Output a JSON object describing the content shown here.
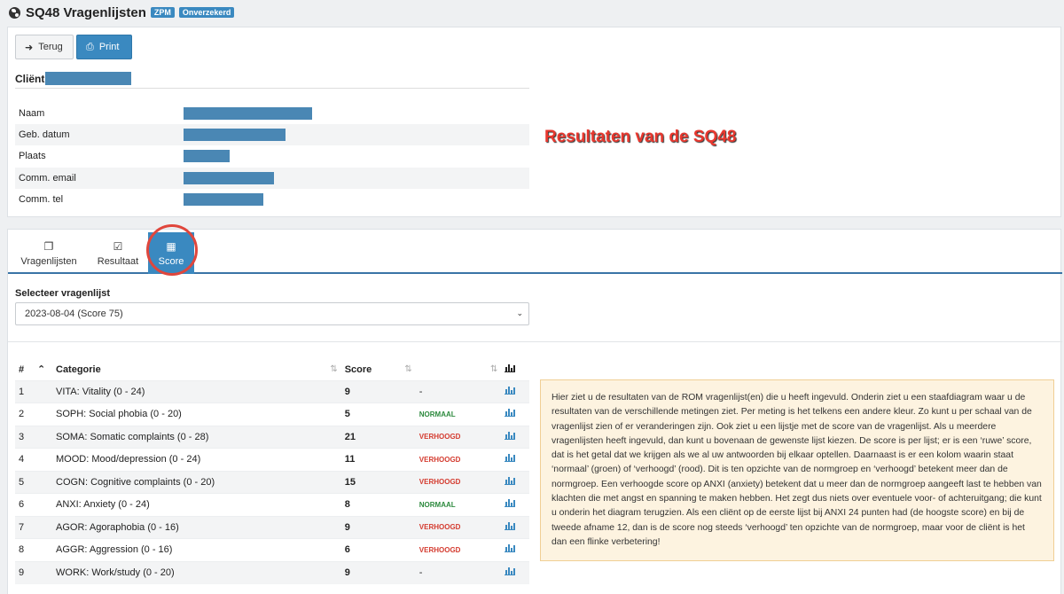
{
  "header": {
    "title": "SQ48 Vragenlijsten",
    "badges": [
      "ZPM",
      "Onverzekerd"
    ]
  },
  "toolbar": {
    "back_label": "Terug",
    "print_label": "Print"
  },
  "client": {
    "heading": "Cliënt",
    "fields": [
      {
        "label": "Naam"
      },
      {
        "label": "Geb. datum"
      },
      {
        "label": "Plaats"
      },
      {
        "label": "Comm. email"
      },
      {
        "label": "Comm. tel"
      }
    ]
  },
  "annotation": "Resultaten van de SQ48",
  "tabs": [
    {
      "label": "Vragenlijsten",
      "icon": "copy-icon"
    },
    {
      "label": "Resultaat",
      "icon": "checkbox-icon"
    },
    {
      "label": "Score",
      "icon": "calculator-icon",
      "active": true
    }
  ],
  "select": {
    "label": "Selecteer vragenlijst",
    "value": "2023-08-04 (Score 75)"
  },
  "table": {
    "headers": {
      "num": "#",
      "category": "Categorie",
      "score": "Score"
    },
    "rows": [
      {
        "num": "1",
        "category": "VITA: Vitality (0 - 24)",
        "score": "9",
        "status": "-"
      },
      {
        "num": "2",
        "category": "SOPH: Social phobia (0 - 20)",
        "score": "5",
        "status": "NORMAAL"
      },
      {
        "num": "3",
        "category": "SOMA: Somatic complaints (0 - 28)",
        "score": "21",
        "status": "VERHOOGD"
      },
      {
        "num": "4",
        "category": "MOOD: Mood/depression (0 - 24)",
        "score": "11",
        "status": "VERHOOGD"
      },
      {
        "num": "5",
        "category": "COGN: Cognitive complaints (0 - 20)",
        "score": "15",
        "status": "VERHOOGD"
      },
      {
        "num": "6",
        "category": "ANXI: Anxiety (0 - 24)",
        "score": "8",
        "status": "NORMAAL"
      },
      {
        "num": "7",
        "category": "AGOR: Agoraphobia (0 - 16)",
        "score": "9",
        "status": "VERHOOGD"
      },
      {
        "num": "8",
        "category": "AGGR: Aggression (0 - 16)",
        "score": "6",
        "status": "VERHOOGD"
      },
      {
        "num": "9",
        "category": "WORK: Work/study (0 - 20)",
        "score": "9",
        "status": "-"
      }
    ]
  },
  "info_text": "Hier ziet u de resultaten van de ROM vragenlijst(en) die u heeft ingevuld. Onderin ziet u een staafdiagram waar u de resultaten van de verschillende metingen ziet. Per meting is het telkens een andere kleur. Zo kunt u per schaal van de vragenlijst zien of er veranderingen zijn. Ook ziet u een lijstje met de score van de vragenlijst. Als u meerdere vragenlijsten heeft ingevuld, dan kunt u bovenaan de gewenste lijst kiezen. De score is per lijst; er is een ‘ruwe’ score, dat is het getal dat we krijgen als we al uw antwoorden bij elkaar optellen. Daarnaast is er een kolom waarin staat ‘normaal’ (groen) of ‘verhoogd’ (rood). Dit is ten opzichte van de normgroep en ‘verhoogd’ betekent meer dan de normgroep. Een verhoogde score op ANXI (anxiety) betekent dat u meer dan de normgroep aangeeft last te hebben van klachten die met angst en spanning te maken hebben. Het zegt dus niets over eventuele voor- of achteruitgang; die kunt u onderin het diagram terugzien. Als een cliënt op de eerste lijst bij ANXI 24 punten had (de hoogste score) en bij de tweede afname 12, dan is de score nog steeds ‘verhoogd’ ten opzichte van de normgroep, maar voor de cliënt is het dan een flinke verbetering!",
  "colors": {
    "accent": "#3a89c0",
    "normal": "#2d8a3e",
    "high": "#d43b2f",
    "annotation": "#e8372e"
  }
}
